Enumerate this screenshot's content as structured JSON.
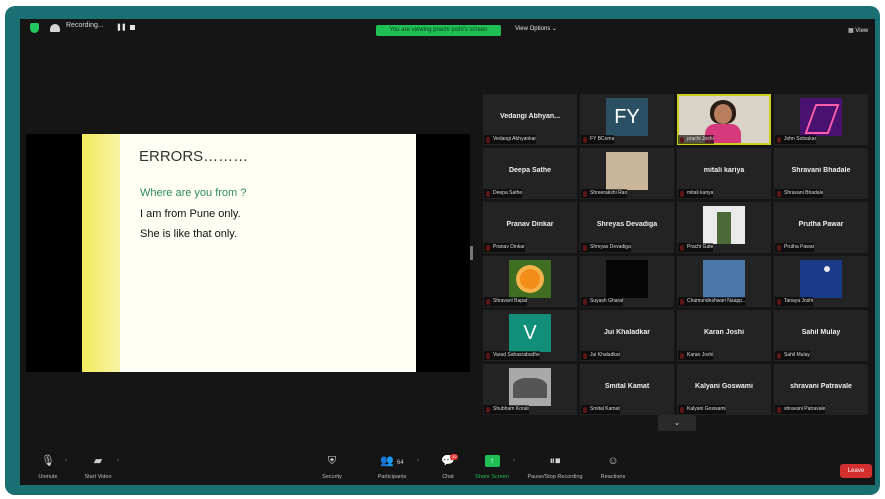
{
  "top_bar": {
    "recording_label": "Recording...",
    "viewing_banner": "You are viewing prachi joshi's screen",
    "view_options_label": "View Options ⌄",
    "view_label": "View"
  },
  "slide": {
    "title": "ERRORS………",
    "question": "Where are you from ?",
    "line1": "I am from Pune only.",
    "line2": "She is like that only."
  },
  "gallery": [
    {
      "center_name": "Vedangi  Abhyan...",
      "label": "Vedangi Abhyankar",
      "photo": "name-only"
    },
    {
      "center_name": "",
      "label": "FY BComa",
      "photo": "fy-tile",
      "photo_text": "FY"
    },
    {
      "center_name": "",
      "label": "prachi Joshi",
      "photo": "video-prachi",
      "active": true
    },
    {
      "center_name": "",
      "label": "John Sotoukar",
      "photo": "abstract-pink"
    },
    {
      "center_name": "Deepa Sathe",
      "label": "Deepa Sathe",
      "photo": "name-only"
    },
    {
      "center_name": "",
      "label": "Shreerakshi Rao",
      "photo": "butterflies"
    },
    {
      "center_name": "mitali kariya",
      "label": "mitali kariya",
      "photo": "name-only"
    },
    {
      "center_name": "Shravani Bhadale",
      "label": "Shravani Bhadale",
      "photo": "name-only"
    },
    {
      "center_name": "Pranav Dinkar",
      "label": "Pranav Dinkar",
      "photo": "name-only"
    },
    {
      "center_name": "Shreyas Devadiga",
      "label": "Shreyas Devadiga",
      "photo": "name-only"
    },
    {
      "center_name": "",
      "label": "Prachi Gate",
      "photo": "tree"
    },
    {
      "center_name": "Prutha Pawar",
      "label": "Prutha Pawar",
      "photo": "name-only"
    },
    {
      "center_name": "",
      "label": "Shravani Bapat",
      "photo": "flower"
    },
    {
      "center_name": "",
      "label": "Suyash Gharat",
      "photo": "dark"
    },
    {
      "center_name": "",
      "label": "Chamundeshwari Naapp...",
      "photo": "blue"
    },
    {
      "center_name": "",
      "label": "Tanaya Joshi",
      "photo": "night-sky"
    },
    {
      "center_name": "",
      "label": "Varad Sahasrabudhe",
      "photo": "v-tile",
      "photo_text": "V"
    },
    {
      "center_name": "Jui Khaladkar",
      "label": "Jui Khaladkar",
      "photo": "name-only"
    },
    {
      "center_name": "Karan Joshi",
      "label": "Karan Joshi",
      "photo": "name-only"
    },
    {
      "center_name": "Sahil Mulay",
      "label": "Sahil Mulay",
      "photo": "name-only"
    },
    {
      "center_name": "",
      "label": "Shubham Korali",
      "photo": "bw-tree"
    },
    {
      "center_name": "Smital Kamat",
      "label": "Smital Kamat",
      "photo": "name-only"
    },
    {
      "center_name": "Kalyani Goswami",
      "label": "Kalyani Goswami",
      "photo": "name-only"
    },
    {
      "center_name": "shravani Patravale",
      "label": "shravani Patravale",
      "photo": "name-only"
    }
  ],
  "toolbar": {
    "unmute": "Unmute",
    "start_video": "Start Video",
    "security": "Security",
    "participants": "Participants",
    "participants_count": "64",
    "chat": "Chat",
    "chat_badge": "10",
    "share_screen": "Share Screen",
    "pause_stop_recording": "Pause/Stop Recording",
    "reactions": "Reactions",
    "leave": "Leave"
  },
  "colors": {
    "frame": "#1a6f73",
    "meeting_bg": "#151515",
    "banner_green": "#1fbf55",
    "leave_red": "#d32f2f",
    "active_speaker": "#c9d11d"
  }
}
